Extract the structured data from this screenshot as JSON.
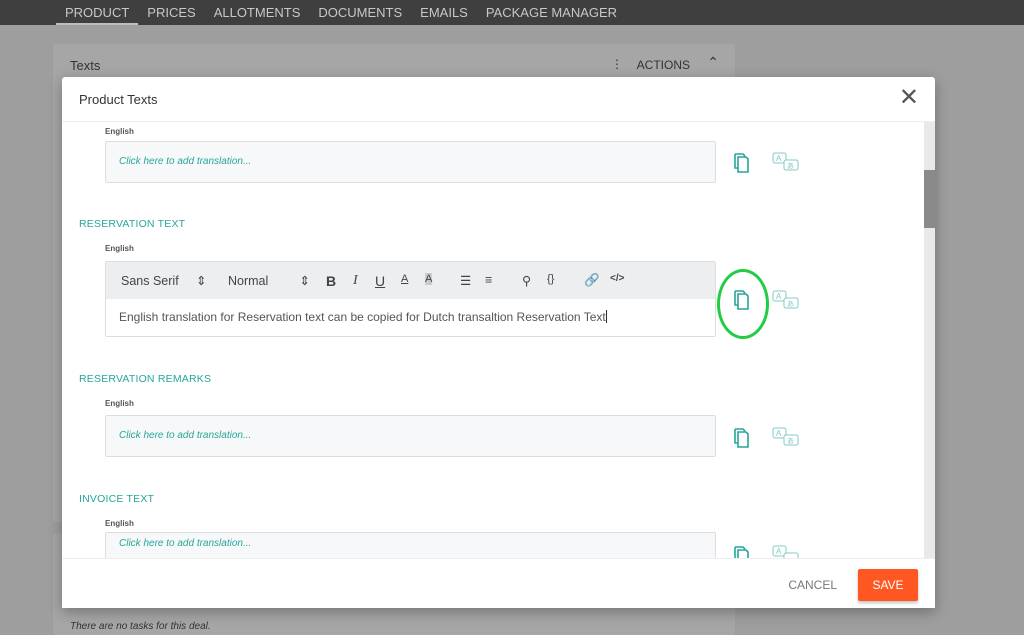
{
  "nav": {
    "tabs": [
      {
        "label": "PRODUCT",
        "active": true
      },
      {
        "label": "PRICES"
      },
      {
        "label": "ALLOTMENTS"
      },
      {
        "label": "DOCUMENTS"
      },
      {
        "label": "EMAILS"
      },
      {
        "label": "PACKAGE MANAGER"
      }
    ]
  },
  "background": {
    "texts_title": "Texts",
    "actions_label": "ACTIONS",
    "tasks_note": "There are no tasks for this deal."
  },
  "modal": {
    "title": "Product Texts",
    "sections": [
      {
        "label": "",
        "language": "English",
        "placeholder": "Click here to add translation..."
      },
      {
        "label": "RESERVATION TEXT",
        "language": "English",
        "value": "English translation for Reservation text can be copied for Dutch transaltion Reservation Text"
      },
      {
        "label": "RESERVATION REMARKS",
        "language": "English",
        "placeholder": "Click here to add translation..."
      },
      {
        "label": "INVOICE TEXT",
        "language": "English",
        "placeholder": "Click here to add translation..."
      }
    ],
    "toolbar": {
      "font": "Sans Serif",
      "size": "Normal",
      "bold": "B",
      "italic": "I",
      "underline": "U",
      "color": "A",
      "background": "A",
      "code_block": "{}",
      "source": "</>"
    },
    "cancel_label": "CANCEL",
    "save_label": "SAVE"
  },
  "colors": {
    "accent": "#26a69a",
    "save": "#ff5722",
    "highlight_circle": "#22cc44"
  }
}
